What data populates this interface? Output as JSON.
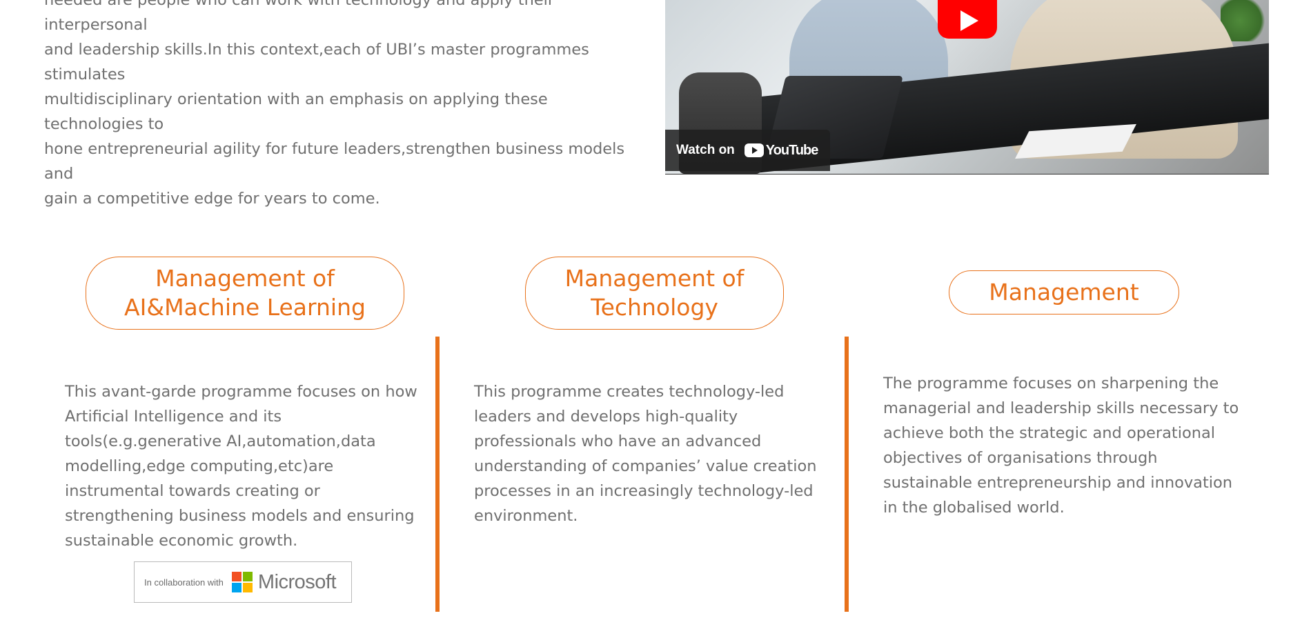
{
  "intro": {
    "lines": [
      "needed are people who can work with technology and apply their interpersonal",
      "and leadership skills.In this context,each of UBI’s master programmes stimulates",
      "multidisciplinary orientation with an emphasis on applying these technologies to",
      "hone entrepreneurial agility for future leaders,strengthen business models and",
      "gain a competitive edge for years to come."
    ]
  },
  "video": {
    "watch_on_label": "Watch on",
    "youtube_label": "YouTube"
  },
  "programmes": [
    {
      "title_line1": "Management of",
      "title_line2": "AI&Machine Learning",
      "description": "This avant-garde programme focuses on how Artificial Intelligence and its tools(e.g.generative AI,automation,data modelling,edge computing,etc)are instrumental towards creating or strengthening business models and ensuring sustainable economic growth.",
      "collab_label": "In collaboration with",
      "partner_name": "Microsoft"
    },
    {
      "title_line1": "Management of",
      "title_line2": "Technology",
      "description": "This programme creates technology-led leaders and develops high-quality professionals who have an advanced understanding of companies’ value creation processes in an increasingly technology-led environment."
    },
    {
      "title_line1": "Management",
      "description": "The programme focuses on sharpening the managerial and leadership skills necessary to achieve both the strategic and operational objectives of organisations through sustainable entrepreneurship and innovation in the globalised world."
    }
  ],
  "colors": {
    "accent": "#e8711a",
    "body_text": "#6f6f6f",
    "youtube_red": "#ff0000",
    "ms_red": "#f25022",
    "ms_green": "#7fba00",
    "ms_blue": "#00a4ef",
    "ms_yellow": "#ffb900"
  },
  "icons": {
    "play": "youtube-play-icon",
    "youtube_logo": "youtube-logo-icon",
    "microsoft_logo": "microsoft-logo-icon"
  }
}
